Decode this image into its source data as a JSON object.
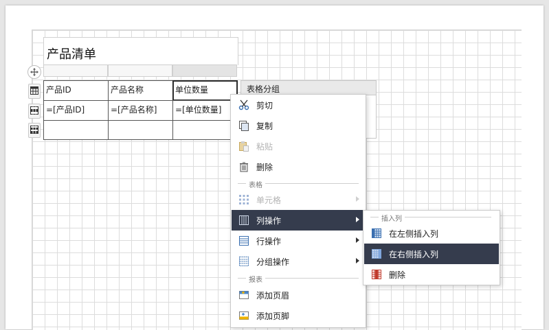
{
  "report": {
    "title": "产品清单",
    "headers": [
      "产品ID",
      "产品名称",
      "单位数量"
    ],
    "bindings": [
      "=[产品ID]",
      "=[产品名称]",
      "=[单位数量]"
    ],
    "group_panel_header": "表格分组"
  },
  "context_menu": {
    "items": {
      "cut": "剪切",
      "copy": "复制",
      "paste": "粘贴",
      "delete": "删除"
    },
    "section_table": "表格",
    "table_items": {
      "cell": "单元格",
      "column_ops": "列操作",
      "row_ops": "行操作",
      "group_ops": "分组操作"
    },
    "section_report": "报表",
    "report_items": {
      "add_header": "添加页眉",
      "add_footer": "添加页脚"
    }
  },
  "submenu": {
    "section": "插入列",
    "insert_left": "在左侧插入列",
    "insert_right": "在右侧插入列",
    "delete": "删除"
  },
  "colors": {
    "active_bg": "#353c4d",
    "accent_blue": "#3a78c2",
    "delete_red": "#c0392b"
  }
}
